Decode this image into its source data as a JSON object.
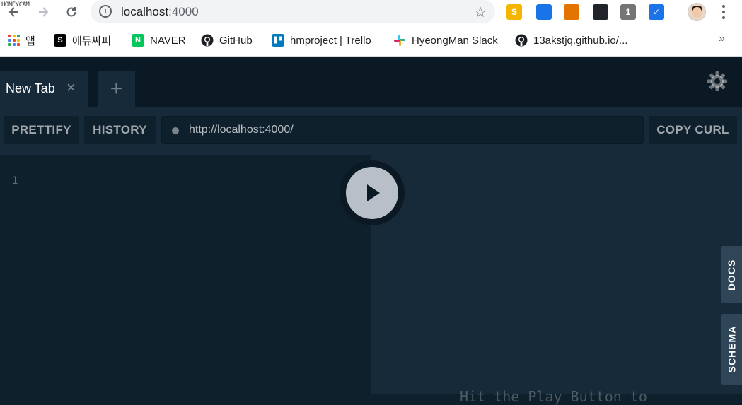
{
  "watermark": "HONEYCAM",
  "browser": {
    "url_host": "localhost",
    "url_port": ":4000",
    "bookmarks": [
      {
        "label": "앱",
        "icon": "apps-icon"
      },
      {
        "label": "에듀싸피",
        "icon": "edussafy-icon"
      },
      {
        "label": "NAVER",
        "icon": "naver-icon"
      },
      {
        "label": "GitHub",
        "icon": "github-icon"
      },
      {
        "label": "hmproject | Trello",
        "icon": "trello-icon"
      },
      {
        "label": "HyeongMan Slack",
        "icon": "slack-icon"
      },
      {
        "label": "13akstjq.github.io/...",
        "icon": "github-icon"
      }
    ],
    "extensions": [
      {
        "name": "sheets-extension-icon",
        "glyph": "S",
        "color": "#f4b400"
      },
      {
        "name": "eyedropper-extension-icon",
        "glyph": "",
        "color": "#1a73e8"
      },
      {
        "name": "ruler-extension-icon",
        "glyph": "",
        "color": "#e37400"
      },
      {
        "name": "react-devtools-icon",
        "glyph": "",
        "color": "#20232a"
      },
      {
        "name": "counter-extension-icon",
        "glyph": "1",
        "color": "#757575"
      },
      {
        "name": "checklist-extension-icon",
        "glyph": "✓",
        "color": "#1a73e8"
      }
    ]
  },
  "playground": {
    "tab_label": "New Tab",
    "buttons": {
      "prettify": "PRETTIFY",
      "history": "HISTORY",
      "copy_curl": "COPY CURL"
    },
    "endpoint_url": "http://localhost:4000/",
    "line_number": "1",
    "hint": "Hit the Play Button to",
    "side_tabs": {
      "docs": "DOCS",
      "schema": "SCHEMA"
    }
  }
}
